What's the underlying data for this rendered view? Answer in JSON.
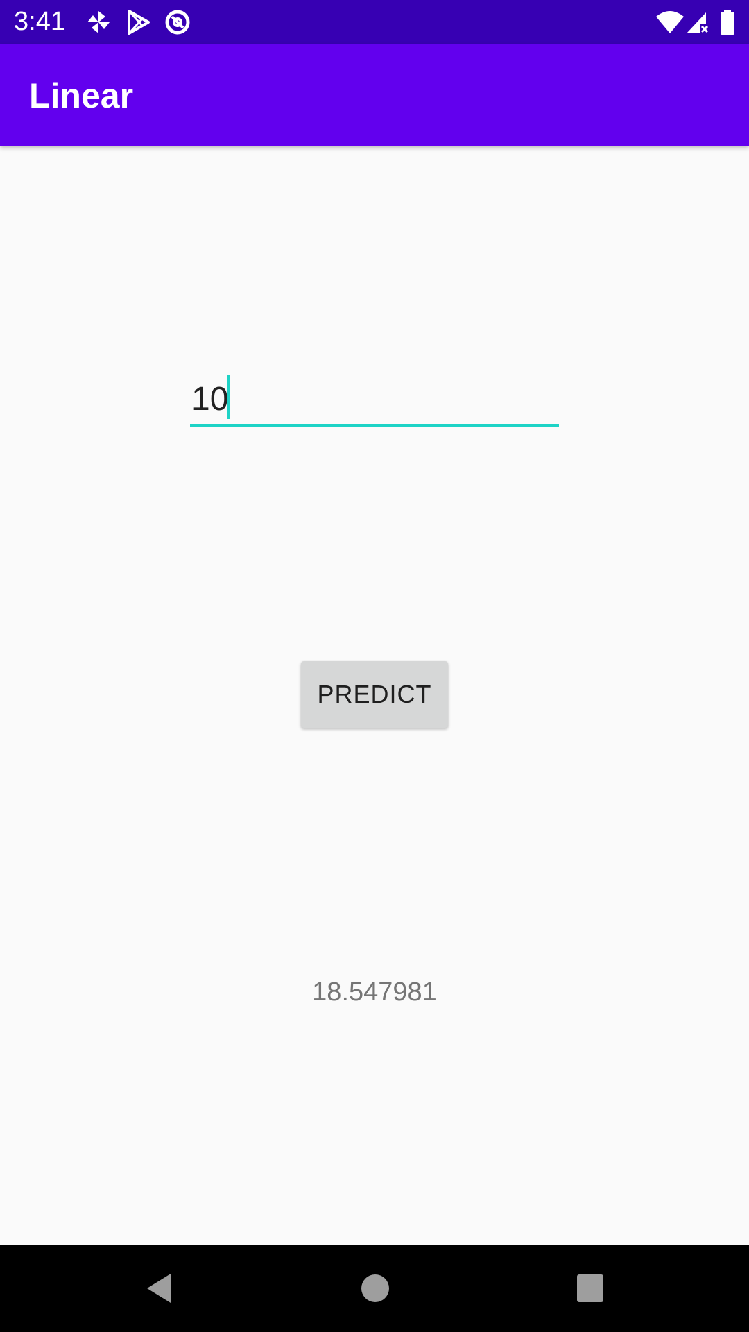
{
  "status_bar": {
    "time": "3:41",
    "notification_icons": [
      "pinwheel-icon",
      "play-store-icon",
      "at-sign-icon"
    ],
    "system_icons": [
      "wifi-icon",
      "cell-signal-no-data-icon",
      "battery-icon"
    ]
  },
  "app_bar": {
    "title": "Linear"
  },
  "main": {
    "input": {
      "value": "10"
    },
    "predict_button": {
      "label": "PREDICT"
    },
    "result": {
      "text": "18.547981"
    }
  },
  "nav_bar": {
    "icons": [
      "back-icon",
      "home-icon",
      "recents-icon"
    ]
  },
  "colors": {
    "status_bar": "#3700b3",
    "app_bar": "#6200ee",
    "accent": "#1ed3c6",
    "button": "#d6d7d7",
    "background": "#fafafa",
    "result_text": "#757575"
  }
}
